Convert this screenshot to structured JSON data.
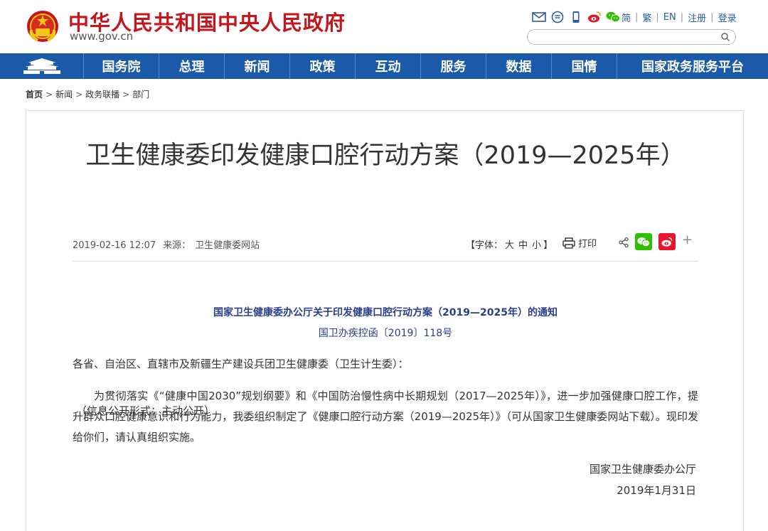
{
  "header": {
    "site_title": "中华人民共和国中央人民政府",
    "site_domain": "www.gov.cn",
    "tools": [
      "mail-icon",
      "subscribe-icon",
      "mobile-icon",
      "weibo-icon",
      "wechat-icon"
    ],
    "links": {
      "simplified": "简",
      "traditional": "繁",
      "english": "EN",
      "register": "注册",
      "login": "登录"
    },
    "search_placeholder": ""
  },
  "nav": {
    "items": [
      "国务院",
      "总理",
      "新闻",
      "政策",
      "互动",
      "服务",
      "数据",
      "国情",
      "国家政务服务平台"
    ]
  },
  "breadcrumb": {
    "home": "首页",
    "items": [
      "新闻",
      "政务联播",
      "部门"
    ]
  },
  "article": {
    "title": "卫生健康委印发健康口腔行动方案（2019—2025年）",
    "datetime": "2019-02-16 12:07",
    "source_label": "来源：",
    "source_name": "卫生健康委网站",
    "font_size_open": "【字体：",
    "font_sizes": [
      "大",
      "中",
      "小"
    ],
    "font_size_close": "】",
    "print_label": "打印",
    "more_share": "+",
    "notice_title": "国家卫生健康委办公厅关于印发健康口腔行动方案（2019—2025年）的通知",
    "doc_number": "国卫办疾控函〔2019〕118号",
    "recipients": "各省、自治区、直辖市及新疆生产建设兵团卫生健康委（卫生计生委）：",
    "body": "为贯彻落实《“健康中国2030”规划纲要》和《中国防治慢性病中长期规划（2017—2025年）》，进一步加强健康口腔工作，提升群众口腔健康意识和行为能力，我委组织制定了《健康口腔行动方案（2019—2025年）》（可从国家卫生健康委网站下载）。现印发给你们，请认真组织实施。",
    "signer": "国家卫生健康委办公厅",
    "sign_date": "2019年1月31日",
    "disclosure": "（信息公开形式：主动公开）"
  },
  "colors": {
    "brand_red": "#c4161c",
    "nav_blue": "#1a5aa8",
    "notice_blue": "#2b3e8c",
    "wechat_green": "#2dc100",
    "weibo_red": "#e6162d"
  }
}
